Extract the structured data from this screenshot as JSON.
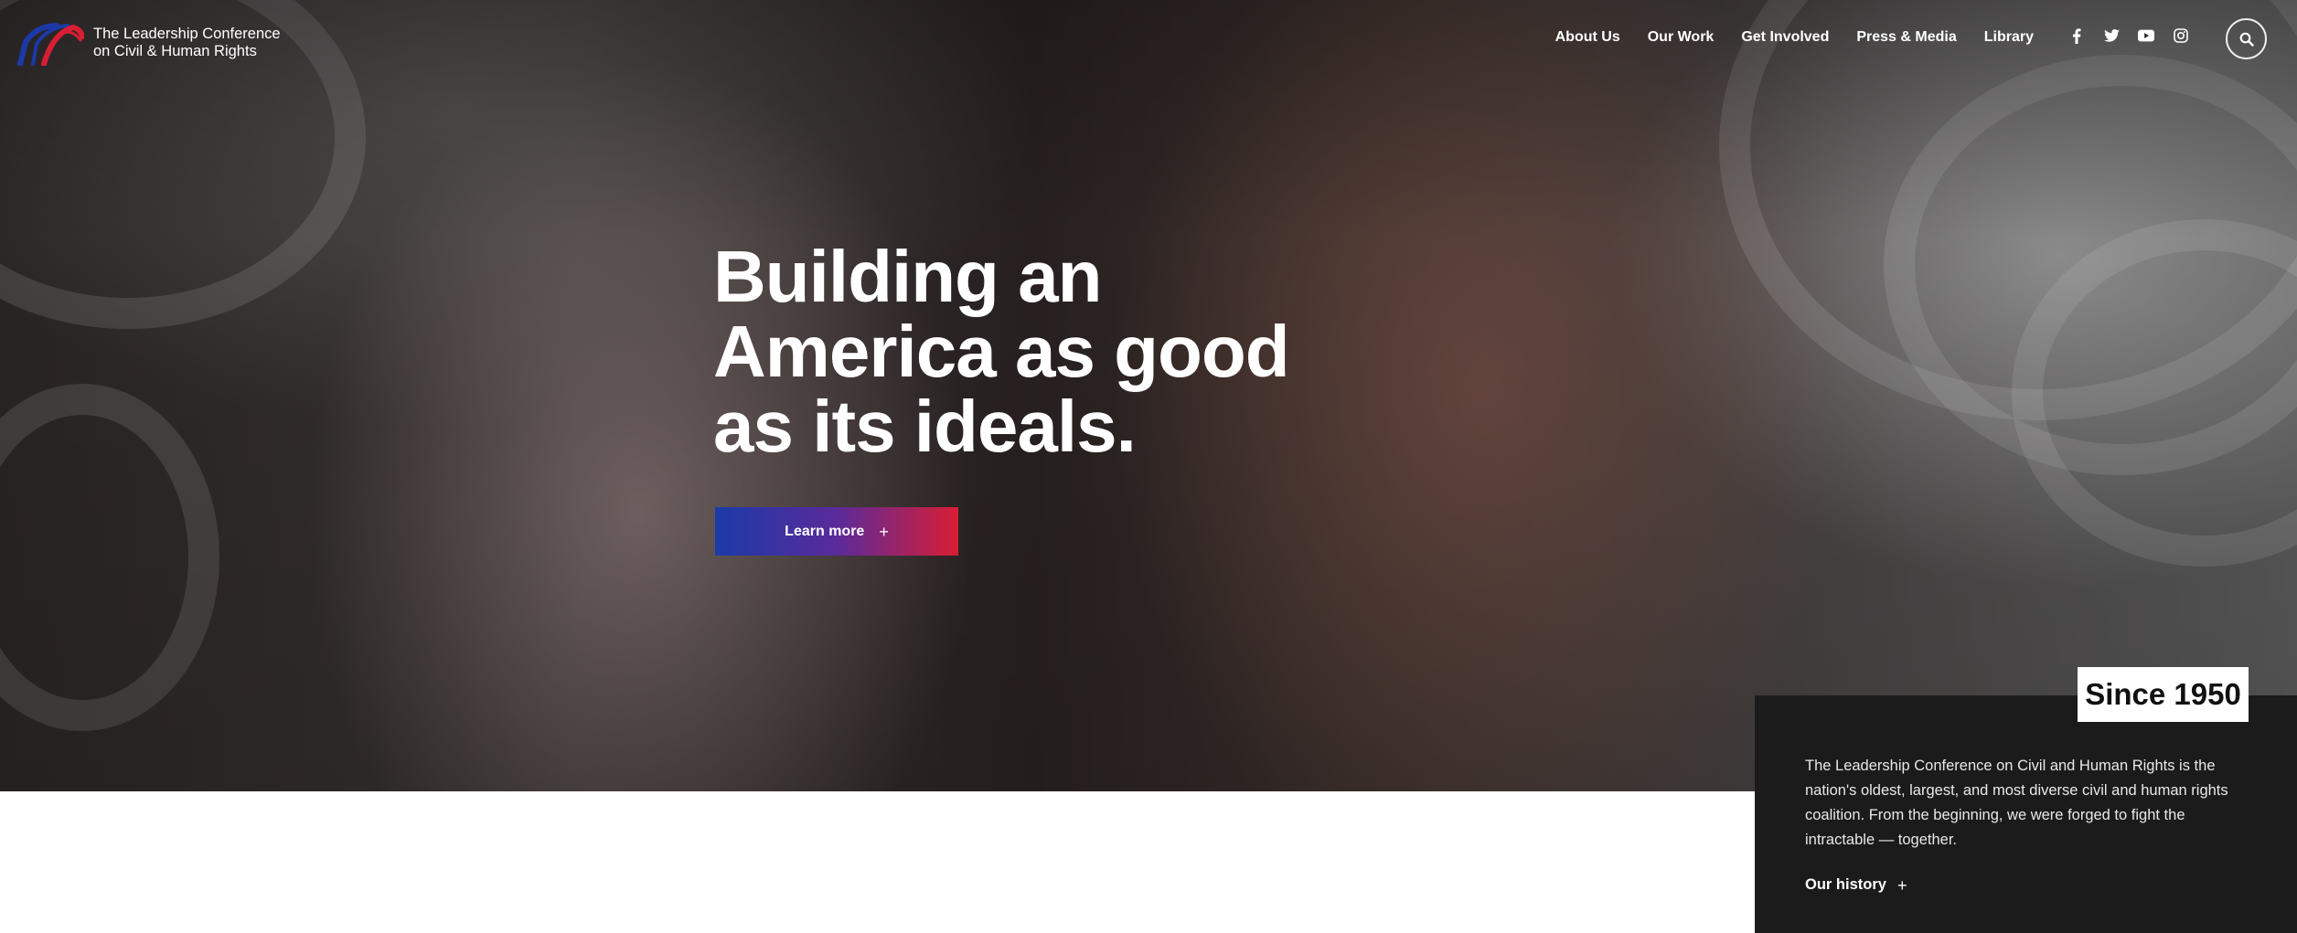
{
  "brand": {
    "name_line1": "The Leadership Conference",
    "name_line2": "on Civil & Human Rights",
    "colors": {
      "blue": "#1b3aa8",
      "red": "#d81e34"
    }
  },
  "nav": {
    "items": [
      {
        "label": "About Us"
      },
      {
        "label": "Our Work"
      },
      {
        "label": "Get Involved"
      },
      {
        "label": "Press & Media"
      },
      {
        "label": "Library"
      }
    ]
  },
  "social": {
    "icons": [
      "facebook-icon",
      "twitter-icon",
      "youtube-icon",
      "instagram-icon"
    ]
  },
  "search": {
    "icon": "search-icon"
  },
  "hero": {
    "title": "Building an America as good as its ideals.",
    "cta_label": "Learn more",
    "cta_icon": "+"
  },
  "since": {
    "badge": "Since 1950",
    "text": "The Leadership Conference on Civil and Human Rights is the nation's oldest, largest, and most diverse civil and human rights coalition. From the beginning, we were forged to fight the intractable — together.",
    "link_label": "Our history",
    "link_icon": "+"
  }
}
